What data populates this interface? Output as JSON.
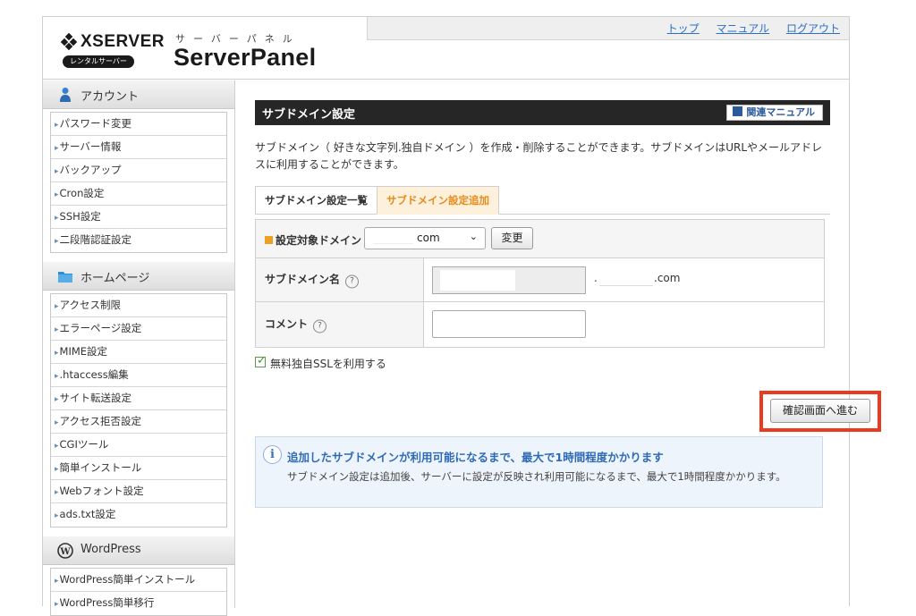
{
  "brand": {
    "logo_word": "XSERVER",
    "logo_badge": "レンタルサーバー",
    "panel_kana": "サーバーパネル",
    "panel_title": "ServerPanel"
  },
  "topnav": [
    "トップ",
    "マニュアル",
    "ログアウト"
  ],
  "sidebar": {
    "sections": [
      {
        "title": "アカウント",
        "icon": "user-icon",
        "items": [
          "パスワード変更",
          "サーバー情報",
          "バックアップ",
          "Cron設定",
          "SSH設定",
          "二段階認証設定"
        ]
      },
      {
        "title": "ホームページ",
        "icon": "folder-icon",
        "items": [
          "アクセス制限",
          "エラーページ設定",
          "MIME設定",
          ".htaccess編集",
          "サイト転送設定",
          "アクセス拒否設定",
          "CGIツール",
          "簡単インストール",
          "Webフォント設定",
          "ads.txt設定"
        ]
      },
      {
        "title": "WordPress",
        "icon": "wordpress-icon",
        "items": [
          "WordPress簡単インストール",
          "WordPress簡単移行"
        ]
      }
    ]
  },
  "main": {
    "title": "サブドメイン設定",
    "manual_label": "関連マニュアル",
    "intro": "サブドメイン（ 好きな文字列.独自ドメイン ）を作成・削除することができます。サブドメインはURLやメールアドレスに利用することができます。",
    "tabs": [
      "サブドメイン設定一覧",
      "サブドメイン設定追加"
    ],
    "active_tab": "サブドメイン設定追加",
    "form": {
      "domain_label": "設定対象ドメイン",
      "domain_value": "com",
      "change_label": "変更",
      "sub_label": "サブドメイン名",
      "sub_dot": ".",
      "sub_suffix": ".com",
      "comment_label": "コメント",
      "help_glyph": "?"
    },
    "ssl_label": "無料独自SSLを利用する",
    "ssl_checked": true,
    "confirm_label": "確認画面へ進む",
    "info": {
      "title": "追加したサブドメインが利用可能になるまで、最大で1時間程度かかります",
      "body": "サブドメイン設定は追加後、サーバーに設定が反映され利用可能になるまで、最大で1時間程度かかります。"
    }
  },
  "colors": {
    "accent_orange": "#e98a1d",
    "highlight_red": "#ea3a1f",
    "link_blue": "#2a6fc9",
    "info_blue": "#2f6bb5"
  }
}
